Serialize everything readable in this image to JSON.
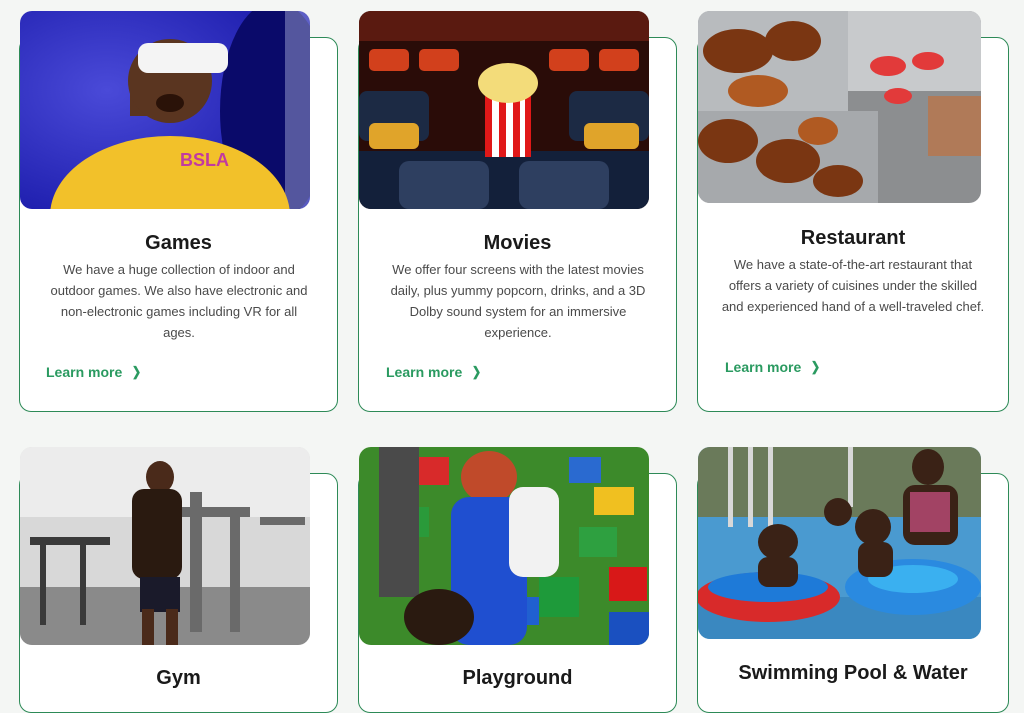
{
  "cards": [
    {
      "title": "Games",
      "description": "We have a huge collection of indoor and outdoor games. We also have electronic and non-electronic games including VR for all ages.",
      "link_label": "Learn more",
      "image_alt": "Person wearing VR headset"
    },
    {
      "title": "Movies",
      "description": "We offer four screens with the latest movies daily, plus yummy popcorn, drinks, and a 3D Dolby sound system for an immersive experience.",
      "link_label": "Learn more",
      "image_alt": "Cinema seats with popcorn"
    },
    {
      "title": "Restaurant",
      "description": "We have a state-of-the-art restaurant that offers a variety of cuisines under the skilled and experienced hand of a well-traveled chef.",
      "link_label": "Learn more",
      "image_alt": "Buffet trays with grilled chicken"
    },
    {
      "title": "Gym",
      "image_alt": "Man working out in gym"
    },
    {
      "title": "Playground",
      "image_alt": "Children playing with building blocks"
    },
    {
      "title": "Swimming Pool & Water",
      "image_alt": "Children in swimming pool"
    }
  ],
  "icons": {
    "link_arrow": "chevron-right-icon"
  },
  "colors": {
    "accent": "#2a9a60",
    "border": "#2d8a57",
    "background": "#f4f6f4"
  }
}
